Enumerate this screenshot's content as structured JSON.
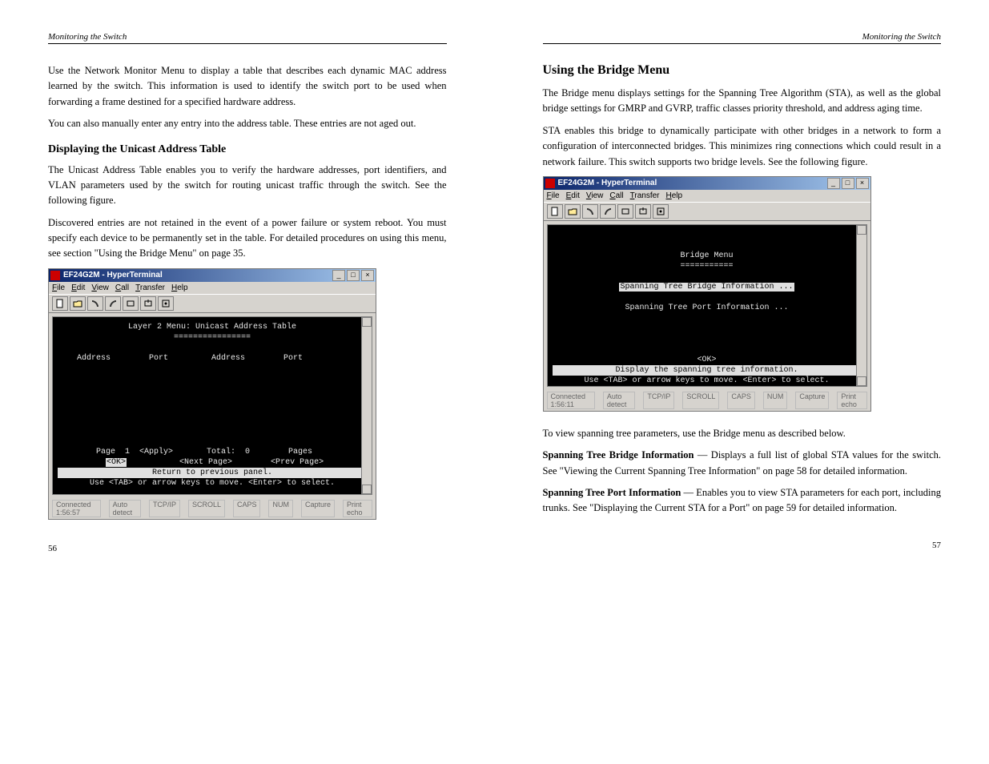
{
  "left": {
    "header_left": "Monitoring the Switch",
    "para1": "Use the Network Monitor Menu to display a table that describes each dynamic MAC address learned by the switch. This information is used to identify the switch port to be used when forwarding a frame destined for a specified hardware address.",
    "para2": "You can also manually enter any entry into the address table. These entries are not aged out.",
    "sub_heading": "Displaying the Unicast Address Table",
    "para3": "The Unicast Address Table enables you to verify the hardware addresses, port identifiers, and VLAN parameters used by the switch for routing unicast traffic through the switch. See the following figure.",
    "para4": "Discovered entries are not retained in the event of a power failure or system reboot. You must specify each device to be permanently set in the table. For detailed procedures on using this menu, see section \"Using the Bridge Menu\" on page 35.",
    "page_number": "56"
  },
  "right": {
    "header_right": "Monitoring the Switch",
    "heading": "Using the Bridge Menu",
    "para1": "The Bridge menu displays settings for the Spanning Tree Algorithm (STA), as well as the global bridge settings for GMRP and GVRP, traffic classes priority threshold, and address aging time.",
    "para2": "STA enables this bridge to dynamically participate with other bridges in a network to form a configuration of interconnected bridges. This minimizes ring connections which could result in a network failure. This switch supports two bridge levels. See the following figure.",
    "para3": "To view spanning tree parameters, use the Bridge menu as described below.",
    "item1_title": "Spanning Tree Bridge Information",
    "item1_text": " — Displays a full list of global STA values for the switch. See \"Viewing the Current Spanning Tree Information\" on page 58 for detailed information.",
    "item2_title": "Spanning Tree Port Information",
    "item2_text": " — Enables you to view STA parameters for each port, including trunks. See \"Displaying the Current STA for a Port\" on page 59 for detailed information.",
    "page_number": "57"
  },
  "screenshot1": {
    "win_title": "EF24G2M - HyperTerminal",
    "menu": [
      "File",
      "Edit",
      "View",
      "Call",
      "Transfer",
      "Help"
    ],
    "term_title": "Layer 2 Menu: Unicast Address Table",
    "col_headers": [
      "Address",
      "Port",
      "Address",
      "Port"
    ],
    "footer_left": "Page  1  <Apply>",
    "footer_mid": "Total:  0",
    "footer_right": "Pages",
    "footer_buttons": "<OK>           <Next Page>        <Prev Page>",
    "help1": "Return to previous panel.",
    "help2": "Use <TAB> or arrow keys to move. <Enter> to select.",
    "status": [
      "Connected 1:56:57",
      "Auto detect",
      "TCP/IP",
      "SCROLL",
      "CAPS",
      "NUM",
      "Capture",
      "Print echo"
    ]
  },
  "screenshot2": {
    "win_title": "EF24G2M - HyperTerminal",
    "menu": [
      "File",
      "Edit",
      "View",
      "Call",
      "Transfer",
      "Help"
    ],
    "term_title": "Bridge Menu",
    "item_selected": "Spanning Tree Bridge Information ...",
    "item_other": "Spanning Tree Port Information ...",
    "ok_btn": "<OK>",
    "help1": "Display the spanning tree information.",
    "help2": "Use <TAB> or arrow keys to move. <Enter> to select.",
    "status": [
      "Connected 1:56:11",
      "Auto detect",
      "TCP/IP",
      "SCROLL",
      "CAPS",
      "NUM",
      "Capture",
      "Print echo"
    ]
  }
}
